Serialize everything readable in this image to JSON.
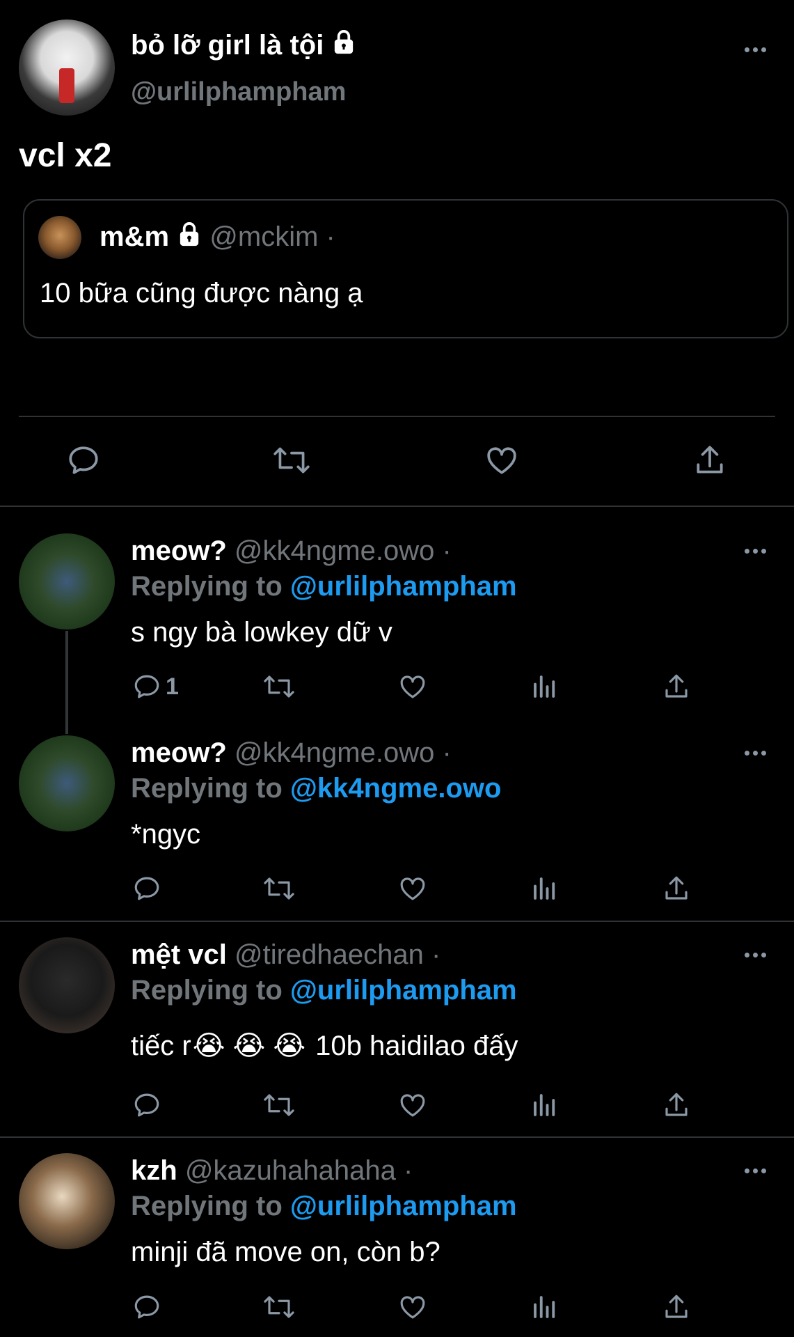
{
  "main_tweet": {
    "display_name": "bỏ lỡ girl là tội",
    "handle": "@urlilphampham",
    "text": "vcl x2"
  },
  "quoted_tweet": {
    "display_name": "m&m",
    "handle": "@mckim",
    "dot": "·",
    "text": "10 bữa cũng được nàng ạ"
  },
  "replies": [
    {
      "display_name": "meow?",
      "handle": "@kk4ngme.owo",
      "dot": "·",
      "replying_label": "Replying to",
      "replying_handle": "@urlilphampham",
      "text": "s ngy bà lowkey dữ v",
      "reply_count": "1"
    },
    {
      "display_name": "meow?",
      "handle": "@kk4ngme.owo",
      "dot": "·",
      "replying_label": "Replying to",
      "replying_handle": "@kk4ngme.owo",
      "text": "*ngyc"
    },
    {
      "display_name": "mệt vcl",
      "handle": "@tiredhaechan",
      "dot": "·",
      "replying_label": "Replying to",
      "replying_handle": "@urlilphampham",
      "text_before": "tiếc r",
      "emoji": "😭 😭 😭",
      "text_after": "10b haidilao đấy"
    },
    {
      "display_name": "kzh",
      "handle": "@kazuhahahaha",
      "dot": "·",
      "replying_label": "Replying to",
      "replying_handle": "@urlilphampham",
      "text": "minji đã move on, còn b?"
    }
  ],
  "colors": {
    "background": "#000000",
    "text": "#ffffff",
    "secondary": "#71767b",
    "link": "#1d9bf0",
    "divider": "#2f3336"
  },
  "icons": [
    "more-icon",
    "lock-icon",
    "reply-icon",
    "retweet-icon",
    "like-icon",
    "analytics-icon",
    "share-icon"
  ]
}
